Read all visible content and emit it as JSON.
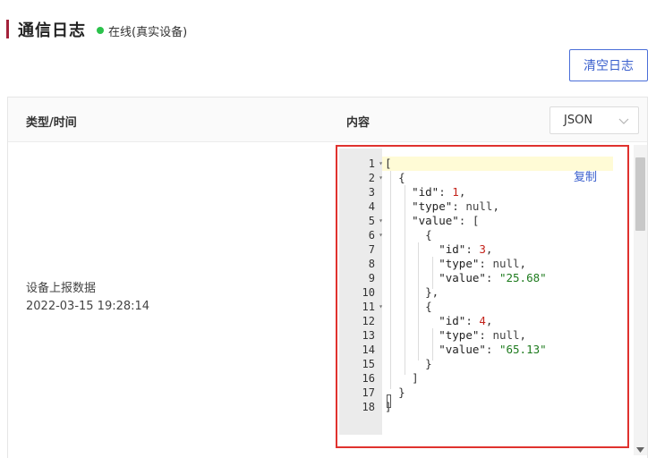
{
  "header": {
    "title": "通信日志",
    "status": "在线(真实设备)",
    "status_color": "#2bc24b"
  },
  "toolbar": {
    "clear_label": "清空日志"
  },
  "table": {
    "col_type": "类型/时间",
    "col_content": "内容",
    "format_select": {
      "value": "JSON",
      "options_visible": [
        "JSON"
      ]
    },
    "rows": [
      {
        "type": "设备上报数据",
        "time": "2022-03-15 19:28:14",
        "copy_label": "复制",
        "line_numbers": [
          "1",
          "2",
          "3",
          "4",
          "5",
          "6",
          "7",
          "8",
          "9",
          "10",
          "11",
          "12",
          "13",
          "14",
          "15",
          "16",
          "17",
          "18"
        ],
        "foldable_lines": [
          1,
          2,
          5,
          6,
          11
        ],
        "content": {
          "open_array": "[",
          "open_obj": "{",
          "id_key": "\"id\"",
          "id_val": "1",
          "type_key": "\"type\"",
          "type_val": "null",
          "value_key": "\"value\"",
          "value_open": "[",
          "item1_open": "{",
          "item1_id": "3",
          "item1_value": "\"25.68\"",
          "item1_close": "},",
          "item2_open": "{",
          "item2_id": "4",
          "item2_value": "\"65.13\"",
          "item2_close": "}",
          "value_close": "]",
          "close_obj": "}",
          "close_array": "]"
        }
      }
    ]
  },
  "colors": {
    "accent": "#a3213a",
    "link": "#3a5fcd",
    "highlight_border": "#e0322e"
  }
}
